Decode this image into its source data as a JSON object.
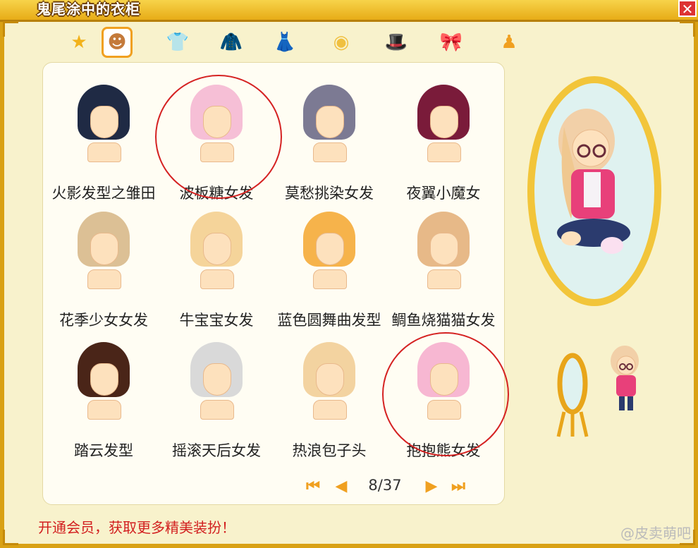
{
  "window": {
    "title": "鬼尾涂中的衣柜",
    "close_label": "✕"
  },
  "tabs": [
    {
      "name": "favorites",
      "icon": "star-icon",
      "glyph": "★",
      "color": "#f2b21b"
    },
    {
      "name": "hair",
      "icon": "hair-icon",
      "glyph": "☻",
      "color": "#c47a3a",
      "active": true
    },
    {
      "name": "tops",
      "icon": "shirt-icon",
      "glyph": "👕",
      "color": "#9fc02c"
    },
    {
      "name": "jackets",
      "icon": "coat-icon",
      "glyph": "🧥",
      "color": "#8a4b22"
    },
    {
      "name": "skirts",
      "icon": "dress-icon",
      "glyph": "👗",
      "color": "#d85a9b"
    },
    {
      "name": "glasses",
      "icon": "face-accessory-icon",
      "glyph": "◉",
      "color": "#f0c040"
    },
    {
      "name": "hats",
      "icon": "hat-icon",
      "glyph": "🎩",
      "color": "#4a86c8"
    },
    {
      "name": "bows",
      "icon": "bow-icon",
      "glyph": "🎀",
      "color": "#ee5f9b"
    },
    {
      "name": "outfit",
      "icon": "outfit-icon",
      "glyph": "♟",
      "color": "#f0a020"
    }
  ],
  "items": [
    {
      "label": "火影发型之雏田",
      "hair_color": "#1f2a44",
      "circled": false
    },
    {
      "label": "波板糖女发",
      "hair_color": "#f6bfd6",
      "circled": true
    },
    {
      "label": "莫愁挑染女发",
      "hair_color": "#7c7a93",
      "circled": false
    },
    {
      "label": "夜翼小魔女",
      "hair_color": "#7a1b3a",
      "circled": false
    },
    {
      "label": "花季少女女发",
      "hair_color": "#dcc095",
      "circled": false
    },
    {
      "label": "牛宝宝女发",
      "hair_color": "#f5d49a",
      "circled": false
    },
    {
      "label": "蓝色圆舞曲发型",
      "hair_color": "#f6b34b",
      "circled": false
    },
    {
      "label": "鲷鱼烧猫猫女发",
      "hair_color": "#e7b988",
      "circled": false
    },
    {
      "label": "踏云发型",
      "hair_color": "#4a2518",
      "circled": false
    },
    {
      "label": "摇滚天后女发",
      "hair_color": "#d9d9d9",
      "circled": false
    },
    {
      "label": "热浪包子头",
      "hair_color": "#f3d3a0",
      "circled": false
    },
    {
      "label": "抱抱熊女发",
      "hair_color": "#f7b7d2",
      "circled": true
    }
  ],
  "pager": {
    "first": "⏮",
    "prev": "◀",
    "page": "8/37",
    "next": "▶",
    "last": "⏭"
  },
  "footer": {
    "promo": "开通会员，获取更多精美装扮！"
  },
  "watermark": "@皮卖萌吧"
}
